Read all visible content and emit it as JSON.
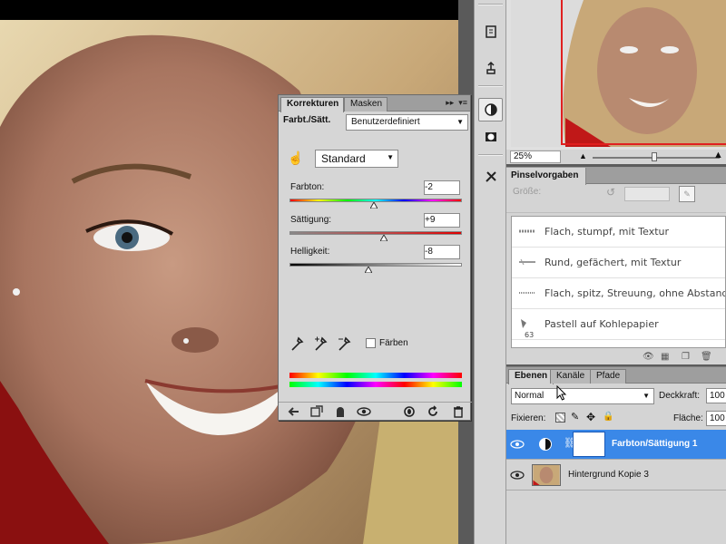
{
  "korrekturen": {
    "tabs": [
      "Korrekturen",
      "Masken"
    ],
    "panel_title": "Farbt./Sätt.",
    "preset": "Benutzerdefiniert",
    "channel": "Standard",
    "sliders": [
      {
        "label": "Farbton:",
        "value": "-2",
        "position": 0.49
      },
      {
        "label": "Sättigung:",
        "value": "+9",
        "position": 0.545
      },
      {
        "label": "Helligkeit:",
        "value": "-8",
        "position": 0.46
      }
    ],
    "colorize_label": "Färben",
    "colorize_checked": false
  },
  "navigator": {
    "zoom": "25%"
  },
  "brush_presets": {
    "tab": "Pinselvorgaben",
    "size_label": "Größe:",
    "items": [
      {
        "label": "Flach, stumpf, mit Textur",
        "number": ""
      },
      {
        "label": "Rund, gefächert, mit Textur",
        "number": ""
      },
      {
        "label": "Flach, spitz, Streuung, ohne Abstand",
        "number": ""
      },
      {
        "label": "Pastell auf Kohlepapier",
        "number": "63"
      }
    ]
  },
  "layers": {
    "tabs": [
      "Ebenen",
      "Kanäle",
      "Pfade"
    ],
    "blend_mode": "Normal",
    "opacity_label": "Deckkraft:",
    "opacity_value": "100",
    "lock_label": "Fixieren:",
    "fill_label": "Fläche:",
    "fill_value": "100",
    "items": [
      {
        "name": "Farbton/Sättigung 1",
        "selected": true
      },
      {
        "name": "Hintergrund Kopie 3",
        "selected": false
      }
    ]
  },
  "colors": {
    "selection": "#3a88e8",
    "navigator_frame": "#e02020",
    "panel_bg": "#d6d6d6"
  }
}
